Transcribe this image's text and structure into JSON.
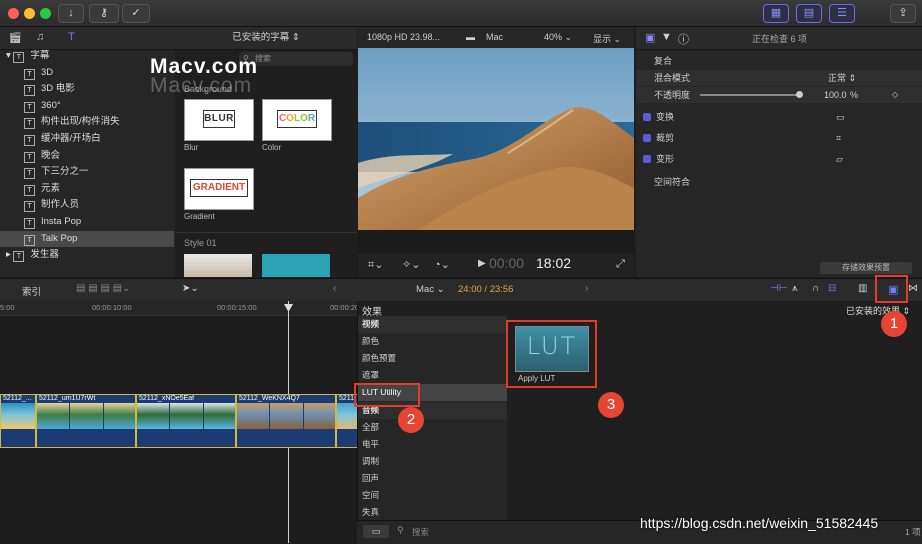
{
  "toolbar": {
    "colors": {
      "close": "#ff5f57",
      "min": "#febc2e",
      "max": "#28c840"
    },
    "icons": [
      "download-icon",
      "key-icon",
      "checkmark-icon",
      "share-icon"
    ],
    "view_icons": [
      "browser-grid-icon",
      "timeline-grid-icon",
      "inspector-sliders-icon"
    ]
  },
  "library": {
    "header": "已安装的字幕 ⇕",
    "items": [
      {
        "label": "字幕",
        "level": 0,
        "expanded": true
      },
      {
        "label": "3D",
        "level": 1
      },
      {
        "label": "3D 电影",
        "level": 1
      },
      {
        "label": "360°",
        "level": 1
      },
      {
        "label": "构件出现/构件消失",
        "level": 1
      },
      {
        "label": "缓冲器/开场白",
        "level": 1
      },
      {
        "label": "晚会",
        "level": 1
      },
      {
        "label": "下三分之一",
        "level": 1
      },
      {
        "label": "元素",
        "level": 1
      },
      {
        "label": "制作人员",
        "level": 1
      },
      {
        "label": "Insta Pop",
        "level": 1
      },
      {
        "label": "Talk Pop",
        "level": 1,
        "selected": true
      },
      {
        "label": "发生器",
        "level": 0,
        "expanded": false
      }
    ],
    "search_placeholder": "搜索"
  },
  "browser": {
    "section1": "Background",
    "section2": "Style 01",
    "thumbs": [
      {
        "text": "BLUR",
        "caption": "Blur"
      },
      {
        "text": "COLOR",
        "caption": "Color"
      },
      {
        "text": "GRADIENT",
        "caption": "Gradient"
      }
    ]
  },
  "watermark": {
    "line1": "Macv.com",
    "line2": "Macv.com"
  },
  "viewer": {
    "format": "1080p HD 23.98...",
    "library": "Mac",
    "zoom": "40% ⌄",
    "display": "显示 ⌄",
    "timecode_dim": "00:00",
    "timecode": "18:02"
  },
  "inspector": {
    "header": "正在检查 6 项",
    "compositing": "复合",
    "blend_label": "混合模式",
    "blend_value": "正常 ⇕",
    "opacity_label": "不透明度",
    "opacity_value": "100.0",
    "opacity_unit": "%",
    "opacity_fraction": 1.0,
    "transform": "变换",
    "crop": "裁剪",
    "distort": "变形",
    "spatial": "空间符合",
    "save_preset": "存储效果预置"
  },
  "timeline_bar": {
    "index": "索引",
    "project": "Mac ⌄",
    "time": "24:00 / 23:56",
    "ruler": [
      "5:00",
      "00:00:10:00",
      "00:00:15:00",
      "00:00:20:00"
    ]
  },
  "clips": [
    {
      "title": "52112_..."
    },
    {
      "title": "52112_um1U7rWt"
    },
    {
      "title": "52112_xNOe5Eaf"
    },
    {
      "title": "52112_WeKNX4Q7"
    },
    {
      "title": "5211"
    }
  ],
  "effects": {
    "title": "效果",
    "installed": "已安装的效果 ⇕",
    "categories": [
      {
        "label": "视频",
        "head": true
      },
      {
        "label": "颜色"
      },
      {
        "label": "颜色预置"
      },
      {
        "label": "遮罩"
      },
      {
        "label": "LUT Utility",
        "selected": true
      },
      {
        "label": "音频",
        "head": true
      },
      {
        "label": "全部"
      },
      {
        "label": "电平"
      },
      {
        "label": "调制"
      },
      {
        "label": "回声"
      },
      {
        "label": "空间"
      },
      {
        "label": "失真"
      }
    ],
    "effect_name": "Apply LUT",
    "effect_thumb_text": "LUT",
    "search_placeholder": "搜索",
    "count": "1 项"
  },
  "annotations": [
    "1",
    "2",
    "3"
  ],
  "url_watermark": "https://blog.csdn.net/weixin_51582445"
}
